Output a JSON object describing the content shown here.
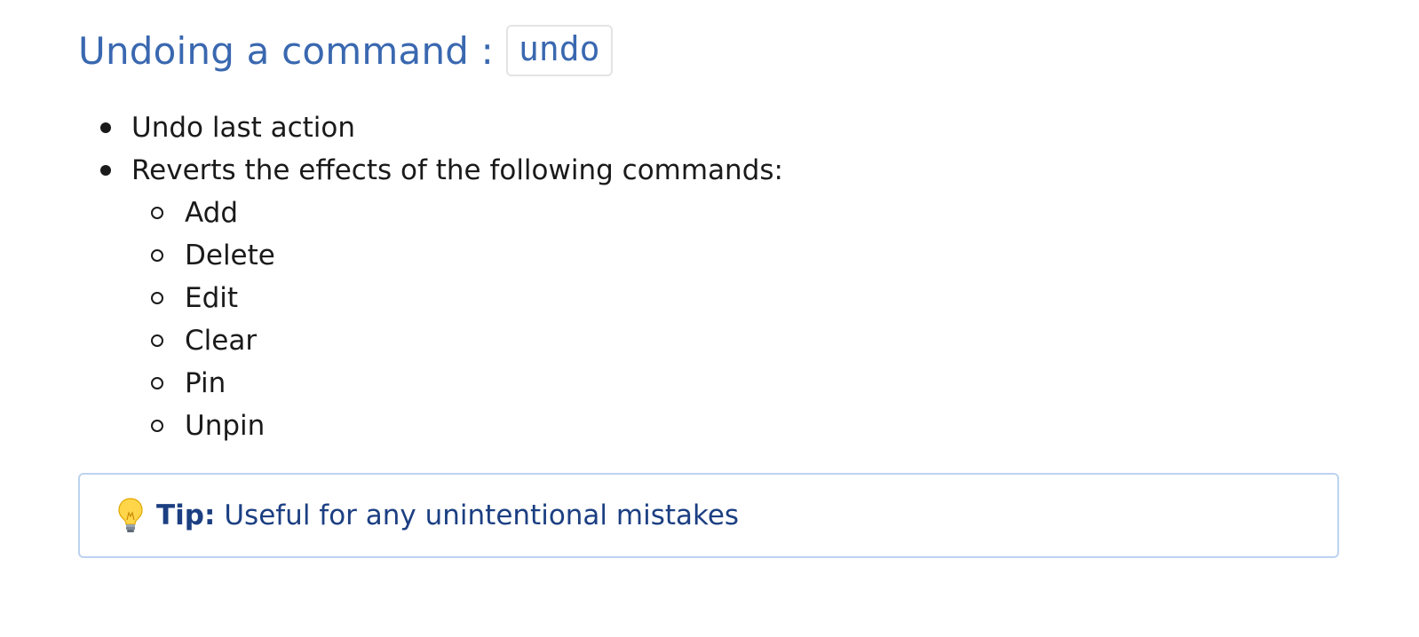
{
  "section": {
    "title": "Undoing a command :",
    "command": "undo"
  },
  "bullets": [
    {
      "text": "Undo last action"
    },
    {
      "text": "Reverts the effects of the following commands:",
      "sub_items": [
        "Add",
        "Delete",
        "Edit",
        "Clear",
        "Pin",
        "Unpin"
      ]
    }
  ],
  "tip": {
    "icon": "lightbulb-icon",
    "label": "Tip:",
    "text": "Useful for any unintentional mistakes",
    "border_color": "#bcd3ef",
    "text_color": "#1c3f82"
  },
  "colors": {
    "heading": "#3a68b0",
    "body_text": "#1a1a1a"
  }
}
